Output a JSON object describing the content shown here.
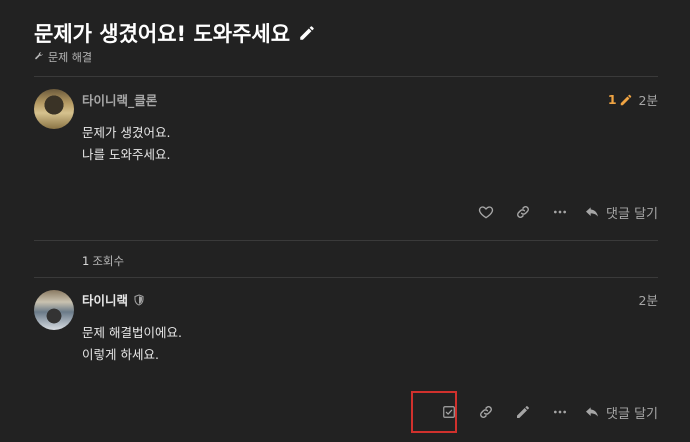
{
  "topic": {
    "title": "문제가 생겼어요! 도와주세요",
    "category": "문제 해결"
  },
  "posts": [
    {
      "username": "타이니랙_클론",
      "edit_count": "1",
      "time": "2분",
      "lines": [
        "문제가 생겼어요.",
        "나를 도와주세요."
      ],
      "reply_label": "댓글 달기"
    },
    {
      "username": "타이니랙",
      "time": "2분",
      "lines": [
        "문제 해결법이에요.",
        "이렇게 하세요."
      ],
      "reply_label": "댓글 달기"
    }
  ],
  "views": {
    "count": "1",
    "label": "조회수"
  },
  "colors": {
    "background": "#222222",
    "accent": "#f0a443",
    "highlight": "#d0312d"
  }
}
